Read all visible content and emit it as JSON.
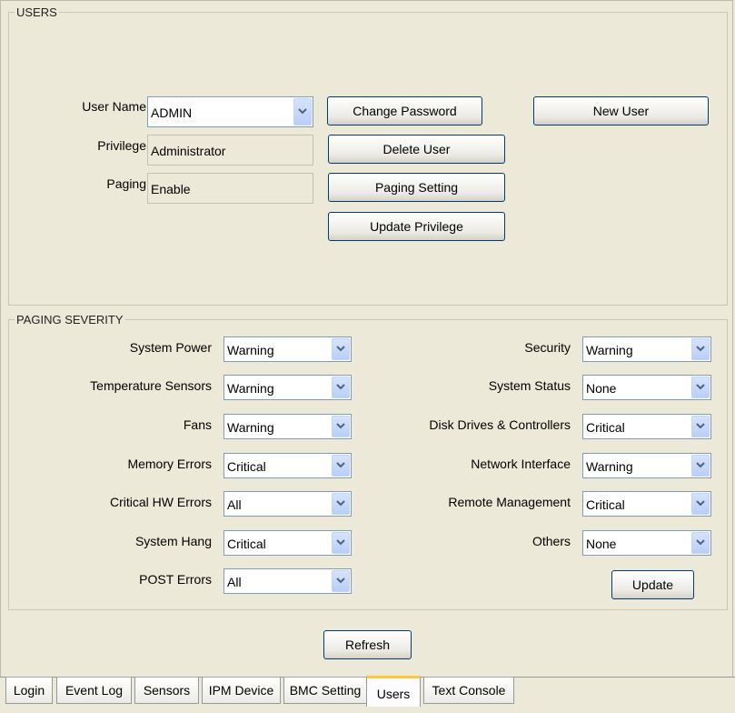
{
  "users": {
    "legend": "USERS",
    "user_name_label": "User Name",
    "user_name_value": "ADMIN",
    "privilege_label": "Privilege",
    "privilege_value": "Administrator",
    "paging_label": "Paging",
    "paging_value": "Enable",
    "buttons": {
      "change_password": "Change Password",
      "new_user": "New User",
      "delete_user": "Delete User",
      "paging_setting": "Paging Setting",
      "update_privilege": "Update Privilege"
    }
  },
  "paging_severity": {
    "legend": "PAGING SEVERITY",
    "left": [
      {
        "label": "System Power",
        "value": "Warning"
      },
      {
        "label": "Temperature Sensors",
        "value": "Warning"
      },
      {
        "label": "Fans",
        "value": "Warning"
      },
      {
        "label": "Memory Errors",
        "value": "Critical"
      },
      {
        "label": "Critical HW Errors",
        "value": "All"
      },
      {
        "label": "System Hang",
        "value": "Critical"
      },
      {
        "label": "POST Errors",
        "value": "All"
      }
    ],
    "right": [
      {
        "label": "Security",
        "value": "Warning"
      },
      {
        "label": "System Status",
        "value": "None"
      },
      {
        "label": "Disk Drives & Controllers",
        "value": "Critical"
      },
      {
        "label": "Network Interface",
        "value": "Warning"
      },
      {
        "label": "Remote Management",
        "value": "Critical"
      },
      {
        "label": "Others",
        "value": "None"
      }
    ],
    "update_button": "Update"
  },
  "refresh_button": "Refresh",
  "tabs": [
    {
      "label": "Login",
      "active": false
    },
    {
      "label": "Event Log",
      "active": false
    },
    {
      "label": "Sensors",
      "active": false
    },
    {
      "label": "IPM Device",
      "active": false
    },
    {
      "label": "BMC Setting",
      "active": false
    },
    {
      "label": "Users",
      "active": true
    },
    {
      "label": "Text Console",
      "active": false
    }
  ],
  "colors": {
    "background": "#ece9d8",
    "combo_border": "#7f9db9",
    "button_border": "#003c74",
    "active_tab_accent": "#ffc83c",
    "tab_text": "#1a1a8c"
  },
  "icons": {
    "dropdown_arrow": "chevron-down-icon"
  }
}
